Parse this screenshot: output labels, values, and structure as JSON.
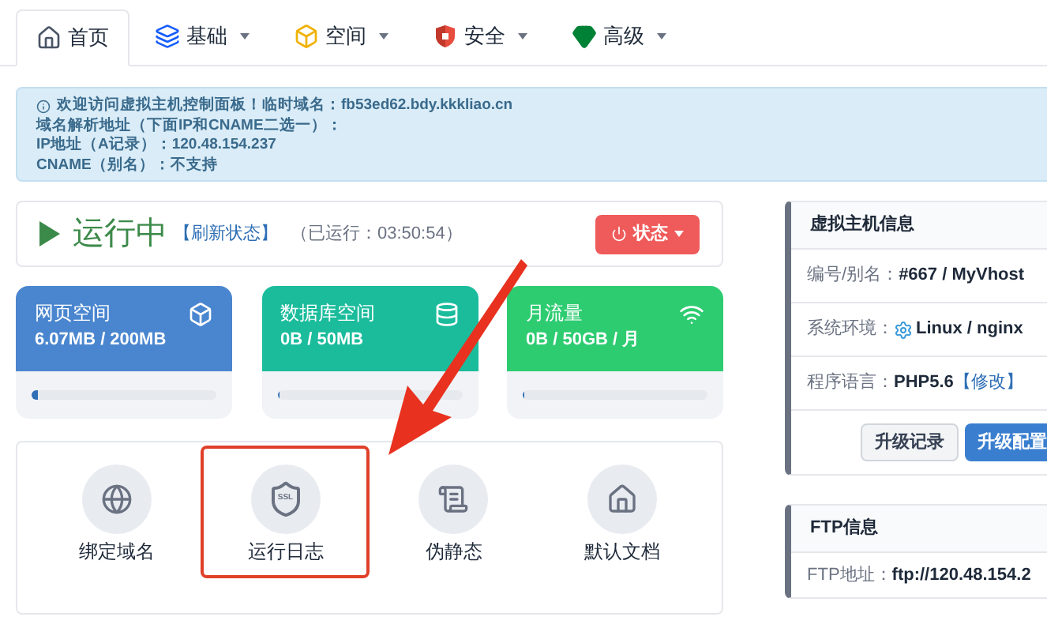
{
  "tabs": [
    {
      "label": "首页",
      "dropdown": false,
      "selected": true
    },
    {
      "label": "基础",
      "dropdown": true,
      "selected": false
    },
    {
      "label": "空间",
      "dropdown": true,
      "selected": false
    },
    {
      "label": "安全",
      "dropdown": true,
      "selected": false
    },
    {
      "label": "高级",
      "dropdown": true,
      "selected": false
    }
  ],
  "notice": {
    "lines": [
      "欢迎访问虚拟主机控制面板！临时域名：**fb53ed62.bdy.kkkliao.cn**",
      "域名解析地址（下面IP和CNAME二选一）：",
      "IP地址（A记录）：**120.48.154.237**",
      "CNAME（别名）：不支持"
    ]
  },
  "status": {
    "running": true,
    "label": "运行中",
    "refresh": "【刷新状态】",
    "uptime": "（已运行：03:50:54）",
    "button": "状态"
  },
  "cards": [
    {
      "title": "网页空间",
      "value": "6.07MB / 200MB",
      "color": "#4a86cf",
      "level": 0.03
    },
    {
      "title": "数据库空间",
      "value": "0B / 50MB",
      "color": "#1abc9c",
      "level": 0
    },
    {
      "title": "月流量",
      "value": "0B / 50GB / 月",
      "color": "#2ecc71",
      "level": 0
    }
  ],
  "shortcuts": [
    {
      "label": "绑定域名",
      "highlighted": false
    },
    {
      "label": "运行日志",
      "icon_text": "SSL",
      "highlighted": true
    },
    {
      "label": "伪静态",
      "highlighted": false
    },
    {
      "label": "默认文档",
      "highlighted": false
    }
  ],
  "annotation_arrow": true,
  "host_info": {
    "title": "虚拟主机信息",
    "rows": [
      {
        "label": "编号/别名：",
        "value": "#667 / MyVhost",
        "kind": "text"
      },
      {
        "label": "系统环境：",
        "value": "Linux / nginx",
        "kind": "os"
      },
      {
        "label": "程序语言：",
        "value": "PHP5.6",
        "link": "【修改】",
        "kind": "link"
      }
    ],
    "buttons": [
      {
        "label": "升级记录",
        "primary": false
      },
      {
        "label": "升级配置",
        "primary": true
      }
    ]
  },
  "ftp_info": {
    "title": "FTP信息",
    "rows": [
      {
        "label": "FTP地址：",
        "value": "ftp://120.48.154.2"
      }
    ]
  }
}
